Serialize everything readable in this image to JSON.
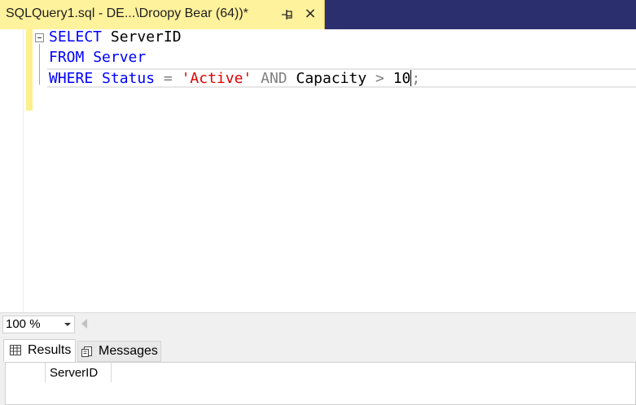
{
  "tab": {
    "title": "SQLQuery1.sql - DE...\\Droopy Bear (64))*",
    "pin_icon": "pin-icon",
    "close_label": "×"
  },
  "editor": {
    "line1": {
      "kw1": "SELECT",
      "rest": " ServerID"
    },
    "line2": {
      "kw1": "FROM",
      "rest": " Server"
    },
    "line3": {
      "kw1": "WHERE",
      "t1": " Status ",
      "op1": "=",
      "sp1": " ",
      "str1": "'Active'",
      "sp2": " ",
      "op2": "AND",
      "t2": " Capacity ",
      "op3": ">",
      "t3": " 10",
      "end": ";"
    }
  },
  "zoom": {
    "value": "100 %"
  },
  "results": {
    "tabs": [
      {
        "label": "Results",
        "icon": "grid-icon"
      },
      {
        "label": "Messages",
        "icon": "messages-icon"
      }
    ],
    "columns": [
      "ServerID"
    ]
  },
  "colors": {
    "keyword": "#0000ff",
    "string": "#e00000",
    "operator": "#808080",
    "tab_active": "#fff29d",
    "tabstrip": "#2b2f6e"
  }
}
